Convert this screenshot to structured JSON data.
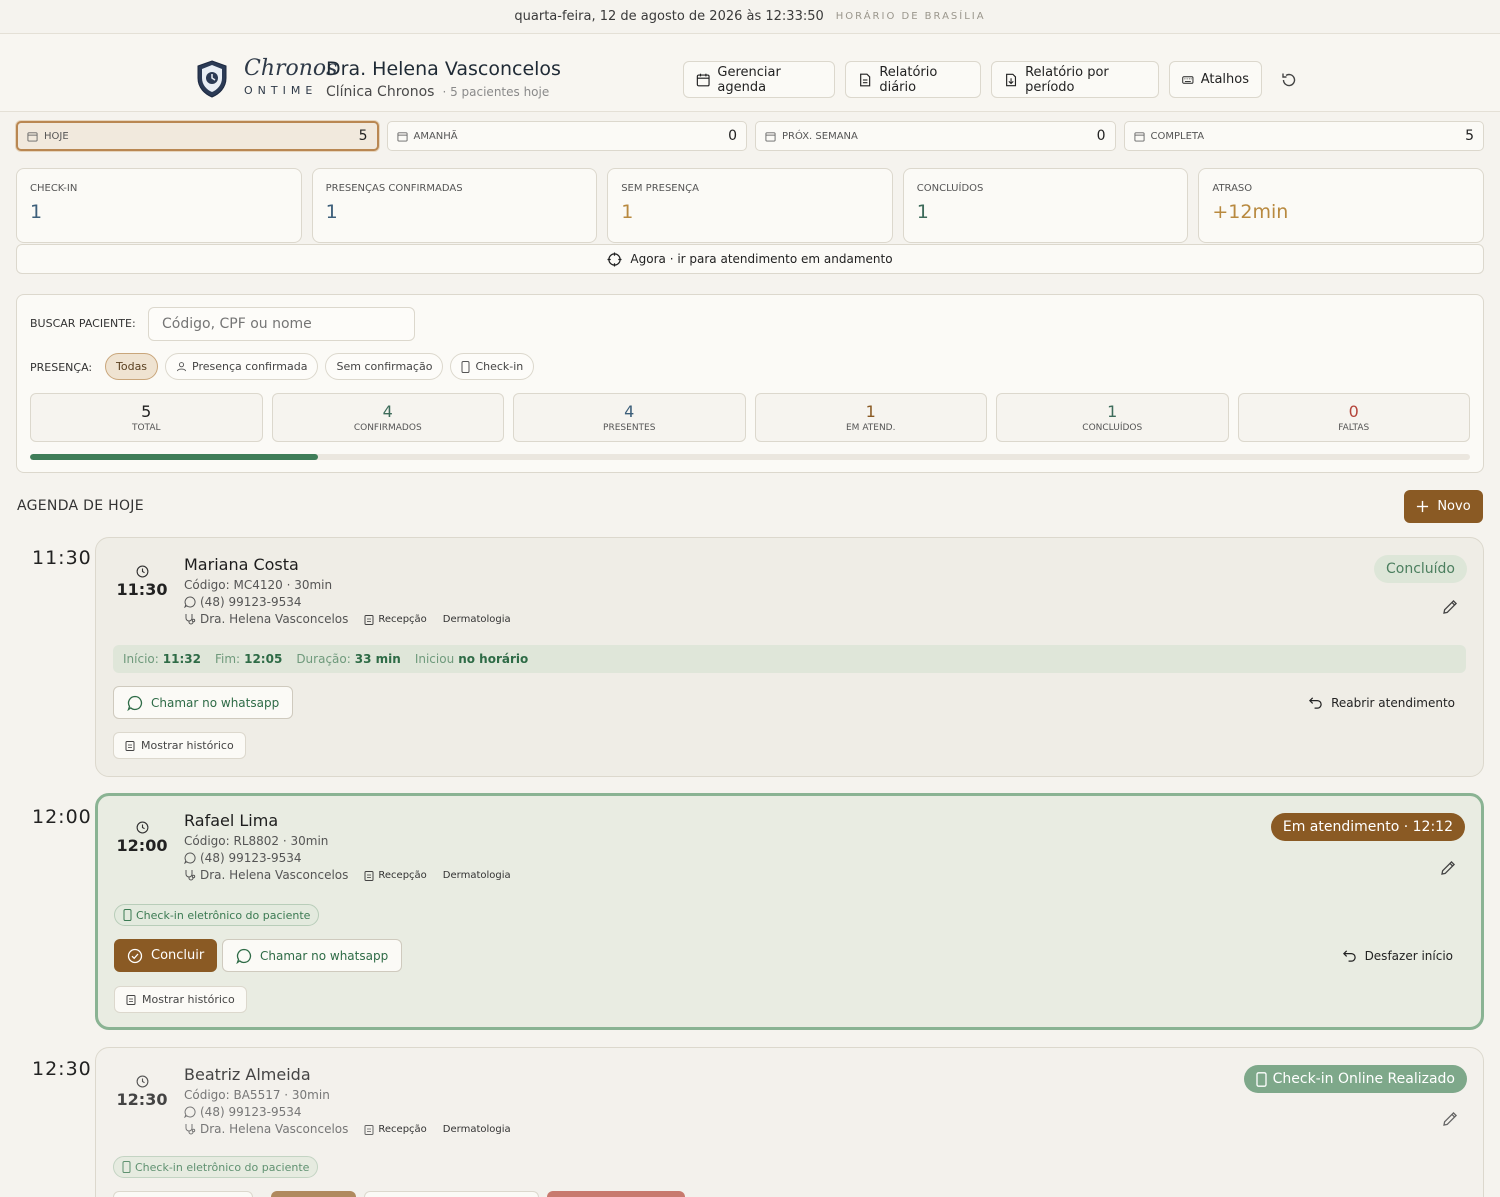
{
  "topbar": {
    "datetime": "quarta-feira, 12 de agosto de 2026 às 12:33:50",
    "timezone": "HORÁRIO DE BRASÍLIA"
  },
  "brand": {
    "name": "Chronos",
    "sub": "ONTIME"
  },
  "doctor": {
    "name": "Dra. Helena Vasconcelos",
    "clinic": "Clínica Chronos",
    "patients_today": "· 5 pacientes hoje"
  },
  "actions": {
    "manage": "Gerenciar agenda",
    "daily": "Relatório diário",
    "period": "Relatório por período",
    "shortcuts": "Atalhos"
  },
  "tabs": [
    {
      "label": "HOJE",
      "count": "5"
    },
    {
      "label": "AMANHÃ",
      "count": "0"
    },
    {
      "label": "PRÓX. SEMANA",
      "count": "0"
    },
    {
      "label": "COMPLETA",
      "count": "5"
    }
  ],
  "stats": [
    {
      "label": "CHECK-IN",
      "value": "1",
      "color": "#3d5f7a"
    },
    {
      "label": "PRESENÇAS CONFIRMADAS",
      "value": "1",
      "color": "#3d5f7a"
    },
    {
      "label": "SEM PRESENÇA",
      "value": "1",
      "color": "#b8893f"
    },
    {
      "label": "CONCLUÍDOS",
      "value": "1",
      "color": "#3d6b5a"
    },
    {
      "label": "ATRASO",
      "value": "+12min",
      "color": "#b8893f"
    }
  ],
  "now_bar": "Agora · ir para atendimento em andamento",
  "search": {
    "label": "BUSCAR PACIENTE:",
    "placeholder": "Código, CPF ou nome"
  },
  "presence": {
    "label": "PRESENÇA:",
    "chips": [
      "Todas",
      "Presença confirmada",
      "Sem confirmação",
      "Check-in"
    ]
  },
  "counts": [
    {
      "value": "5",
      "label": "TOTAL",
      "color": "#222222"
    },
    {
      "value": "4",
      "label": "CONFIRMADOS",
      "color": "#3d6b5a"
    },
    {
      "value": "4",
      "label": "PRESENTES",
      "color": "#3d5f7a"
    },
    {
      "value": "1",
      "label": "EM ATEND.",
      "color": "#8a5a24"
    },
    {
      "value": "1",
      "label": "CONCLUÍDOS",
      "color": "#3d6b5a"
    },
    {
      "value": "0",
      "label": "FALTAS",
      "color": "#b4443a"
    }
  ],
  "progress_fraction": 0.2,
  "agenda": {
    "title": "AGENDA DE HOJE",
    "new_button": "Novo",
    "appointments": [
      {
        "time": "11:30",
        "name": "Mariana Costa",
        "code": "Código: MC4120 · 30min",
        "phone": "(48) 99123-9534",
        "doctor": "Dra. Helena Vasconcelos",
        "source": "Recepção",
        "specialty": "Dermatologia",
        "status": "Concluído",
        "timeline": {
          "start_label": "Início:",
          "start": "11:32",
          "end_label": "Fim:",
          "end": "12:05",
          "duration_label": "Duração:",
          "duration": "33 min",
          "note_label": "Iniciou",
          "note": "no horário"
        },
        "whatsapp": "Chamar no whatsapp",
        "reopen": "Reabrir atendimento",
        "history": "Mostrar histórico"
      },
      {
        "time": "12:00",
        "name": "Rafael Lima",
        "code": "Código: RL8802 · 30min",
        "phone": "(48) 99123-9534",
        "doctor": "Dra. Helena Vasconcelos",
        "source": "Recepção",
        "specialty": "Dermatologia",
        "status": "Em atendimento · 12:12",
        "echeck": "Check-in eletrônico do paciente",
        "conclude": "Concluir",
        "whatsapp": "Chamar no whatsapp",
        "undo": "Desfazer início",
        "history": "Mostrar histórico"
      },
      {
        "time": "12:30",
        "name": "Beatriz Almeida",
        "code": "Código: BA5517 · 30min",
        "phone": "(48) 99123-9534",
        "doctor": "Dra. Helena Vasconcelos",
        "source": "Recepção",
        "specialty": "Dermatologia",
        "status": "Check-in Online Realizado",
        "echeck": "Check-in eletrônico do paciente"
      }
    ]
  }
}
